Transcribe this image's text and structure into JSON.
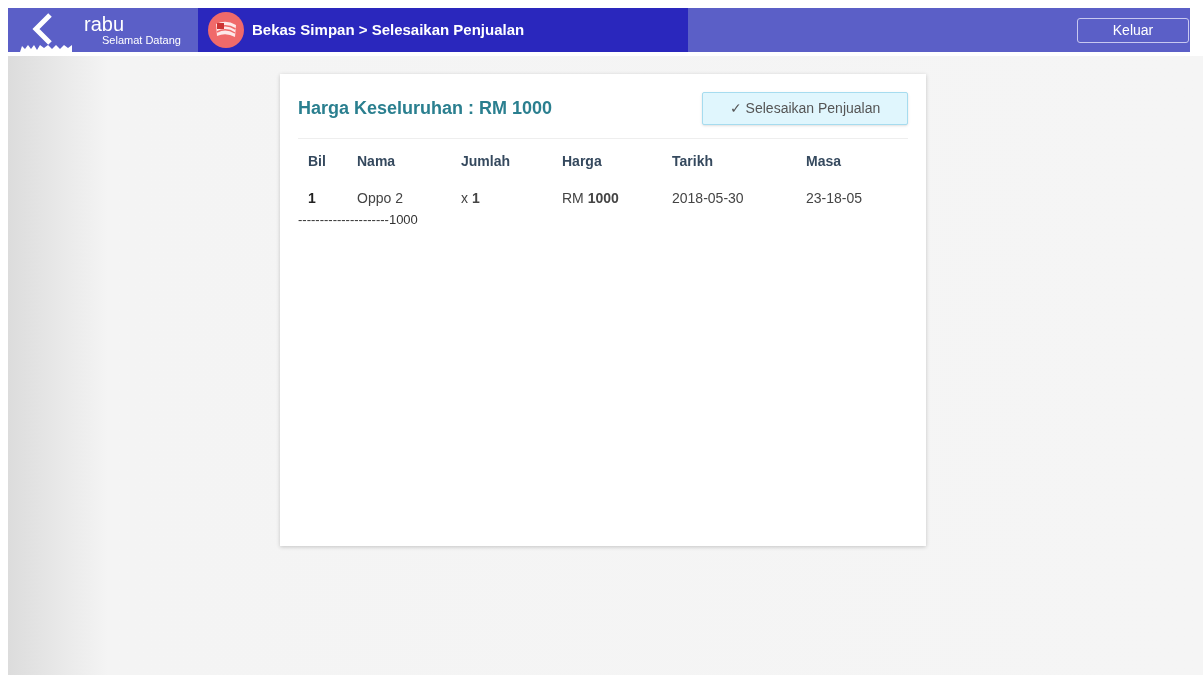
{
  "header": {
    "user": "rabu",
    "greeting": "Selamat Datang",
    "breadcrumb": "Bekas Simpan > Selesaikan Penjualan",
    "logout": "Keluar"
  },
  "card": {
    "title": "Harga Keseluruhan : RM 1000",
    "action": "✓ Selesaikan Penjualan",
    "table": {
      "columns": [
        "Bil",
        "Nama",
        "Jumlah",
        "Harga",
        "Tarikh",
        "Masa"
      ],
      "rows": [
        [
          "1",
          "Oppo 2",
          "x **1**",
          "RM **1000**",
          "2018-05-30",
          "23-18-05"
        ]
      ]
    },
    "total_line": "---------------------1000"
  }
}
